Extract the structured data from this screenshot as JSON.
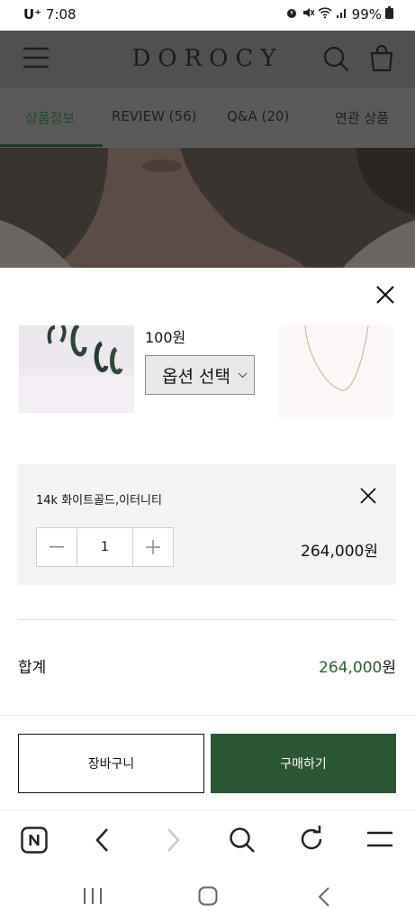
{
  "status_bar": {
    "carrier": "U⁺",
    "time": "7:08",
    "battery": "99%",
    "icons": [
      "alarm-icon",
      "mute-icon",
      "wifi-icon",
      "signal-icon",
      "battery-icon"
    ]
  },
  "header": {
    "brand": "DOROCY",
    "icons": [
      "menu-icon",
      "search-icon",
      "shopping-bag-icon"
    ]
  },
  "tabs": [
    {
      "label": "상품정보",
      "active": true
    },
    {
      "label": "REVIEW (56)",
      "active": false
    },
    {
      "label": "Q&A (20)",
      "active": false
    },
    {
      "label": "연관 상품",
      "active": false
    }
  ],
  "sheet": {
    "price_fragment": "100원",
    "option_select_label": "옵션 선택",
    "selected_option": {
      "name": "14k 화이트골드,이터니티",
      "quantity": "1",
      "price": "264,000원"
    },
    "total": {
      "label": "합계",
      "amount": "264,000",
      "unit": "원"
    },
    "cart_button": "장바구니",
    "buy_button": "구매하기"
  },
  "colors": {
    "accent_green": "#2b5633",
    "total_green": "#2d5c36",
    "active_tab": "#2e5f36"
  },
  "browser_toolbar": [
    "naver-icon",
    "back-icon",
    "forward-icon",
    "search-icon",
    "refresh-icon",
    "menu-icon"
  ],
  "system_nav": [
    "recents-icon",
    "home-icon",
    "back-icon"
  ]
}
